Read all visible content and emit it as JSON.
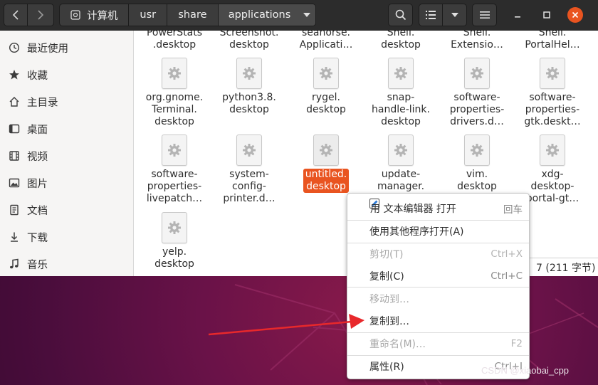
{
  "header": {
    "path_segments": [
      "计算机",
      "usr",
      "share",
      "applications"
    ]
  },
  "sidebar": {
    "items": [
      {
        "label": "最近使用",
        "icon": "clock-icon"
      },
      {
        "label": "收藏",
        "icon": "star-icon"
      },
      {
        "label": "主目录",
        "icon": "home-icon"
      },
      {
        "label": "桌面",
        "icon": "desktop-icon"
      },
      {
        "label": "视频",
        "icon": "video-icon"
      },
      {
        "label": "图片",
        "icon": "picture-icon"
      },
      {
        "label": "文档",
        "icon": "document-icon"
      },
      {
        "label": "下载",
        "icon": "download-icon"
      },
      {
        "label": "音乐",
        "icon": "music-icon"
      }
    ]
  },
  "files": {
    "top_row": [
      [
        "PowerStats",
        ".desktop"
      ],
      [
        "Screenshot.",
        "desktop"
      ],
      [
        "seahorse.",
        "Applicati…"
      ],
      [
        "Shell.",
        "desktop"
      ],
      [
        "Shell.",
        "Extensio…"
      ],
      [
        "Shell.",
        "PortalHel…"
      ]
    ],
    "row1": [
      [
        "org.gnome.",
        "Terminal.",
        "desktop"
      ],
      [
        "python3.8.",
        "desktop"
      ],
      [
        "rygel.",
        "desktop"
      ],
      [
        "snap-",
        "handle-link.",
        "desktop"
      ],
      [
        "software-",
        "properties-",
        "drivers.d…"
      ],
      [
        "software-",
        "properties-",
        "gtk.deskt…"
      ]
    ],
    "row2": [
      [
        "software-",
        "properties-",
        "livepatch…"
      ],
      [
        "system-",
        "config-",
        "printer.d…"
      ],
      [
        "untitled.",
        "desktop"
      ],
      [
        "update-",
        "manager."
      ],
      [
        "vim.",
        "desktop"
      ],
      [
        "xdg-",
        "desktop-",
        "portal-gt…"
      ]
    ],
    "row3": [
      [
        "yelp.",
        "desktop"
      ]
    ],
    "selected": "untitled.desktop"
  },
  "status": {
    "text": "7 (211 字节)"
  },
  "context_menu": {
    "items": [
      {
        "label": "用 文本编辑器 打开",
        "accel": "回车",
        "enabled": true
      },
      {
        "label": "使用其他程序打开(A)",
        "accel": "",
        "enabled": true
      },
      {
        "label": "剪切(T)",
        "accel": "Ctrl+X",
        "enabled": false
      },
      {
        "label": "复制(C)",
        "accel": "Ctrl+C",
        "enabled": true
      },
      {
        "label": "移动到…",
        "accel": "",
        "enabled": false
      },
      {
        "label": "复制到…",
        "accel": "",
        "enabled": true
      },
      {
        "label": "重命名(M)…",
        "accel": "F2",
        "enabled": false
      },
      {
        "label": "属性(R)",
        "accel": "Ctrl+I",
        "enabled": true
      }
    ]
  },
  "watermark": "CSDN @xiaobai_cpp",
  "colors": {
    "accent": "#e95420",
    "headerbar": "#2c2c2c",
    "arrow": "#e8282b"
  }
}
